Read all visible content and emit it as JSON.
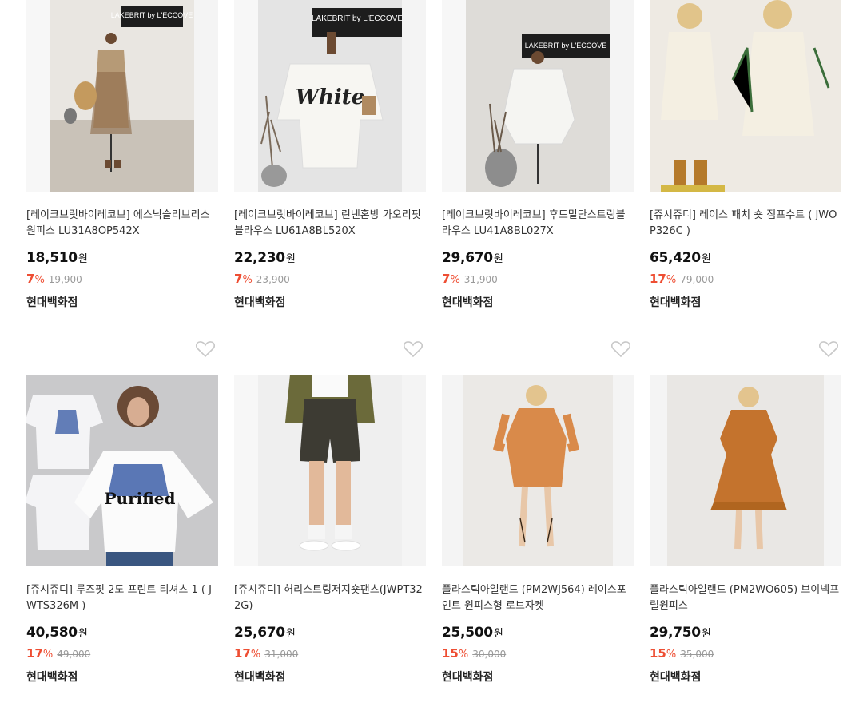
{
  "products": [
    {
      "title": "[레이크브릿바이레코브] 에스닉슬리브리스원피스 LU31A8OP542X",
      "price": "18,510",
      "unit": "원",
      "rate": "7",
      "pct": "%",
      "orig": "19,900",
      "store": "현대백화점",
      "image": "mannequin-ethnic-dress",
      "sign": "LAKEBRIT by L'ECCOVE"
    },
    {
      "title": "[레이크브릿바이레코브] 린넨혼방 가오리핏 블라우스 LU61A8BL520X",
      "price": "22,230",
      "unit": "원",
      "rate": "7",
      "pct": "%",
      "orig": "23,900",
      "store": "현대백화점",
      "image": "mannequin-white-blouse",
      "sign": "LAKEBRIT by L'ECCOVE",
      "shirt_text": "White"
    },
    {
      "title": "[레이크브릿바이레코브] 후드밑단스트링블라우스 LU41A8BL027X",
      "price": "29,670",
      "unit": "원",
      "rate": "7",
      "pct": "%",
      "orig": "31,900",
      "store": "현대백화점",
      "image": "mannequin-hood-blouse",
      "sign": "LAKEBRIT by L'ECCOVE"
    },
    {
      "title": "[쥬시쥬디] 레이스 패치 숏 점프수트 ( JWOP326C )",
      "price": "65,420",
      "unit": "원",
      "rate": "17",
      "pct": "%",
      "orig": "79,000",
      "store": "현대백화점",
      "image": "model-cream-jumpsuit"
    },
    {
      "title": "[쥬시쥬디] 루즈핏 2도 프린트 티셔츠 1 ( JWTS326M )",
      "price": "40,580",
      "unit": "원",
      "rate": "17",
      "pct": "%",
      "orig": "49,000",
      "store": "현대백화점",
      "image": "model-purified-tshirt",
      "shirt_text": "Purified"
    },
    {
      "title": "[쥬시쥬디] 허리스트링저지숏팬츠(JWPT322G)",
      "price": "25,670",
      "unit": "원",
      "rate": "17",
      "pct": "%",
      "orig": "31,000",
      "store": "현대백화점",
      "image": "model-black-shorts"
    },
    {
      "title": "플라스틱아일랜드 (PM2WJ564) 레이스포인트 원피스형 로브자켓",
      "price": "25,500",
      "unit": "원",
      "rate": "15",
      "pct": "%",
      "orig": "30,000",
      "store": "현대백화점",
      "image": "model-orange-robe"
    },
    {
      "title": "플라스틱아일랜드 (PM2WO605) 브이넥프릴원피스",
      "price": "29,750",
      "unit": "원",
      "rate": "15",
      "pct": "%",
      "orig": "35,000",
      "store": "현대백화점",
      "image": "model-brown-dress"
    }
  ],
  "icons": {
    "wishlist": "heart-outline-icon"
  },
  "colors": {
    "discount": "#ee4e33",
    "original_price": "#999999"
  }
}
